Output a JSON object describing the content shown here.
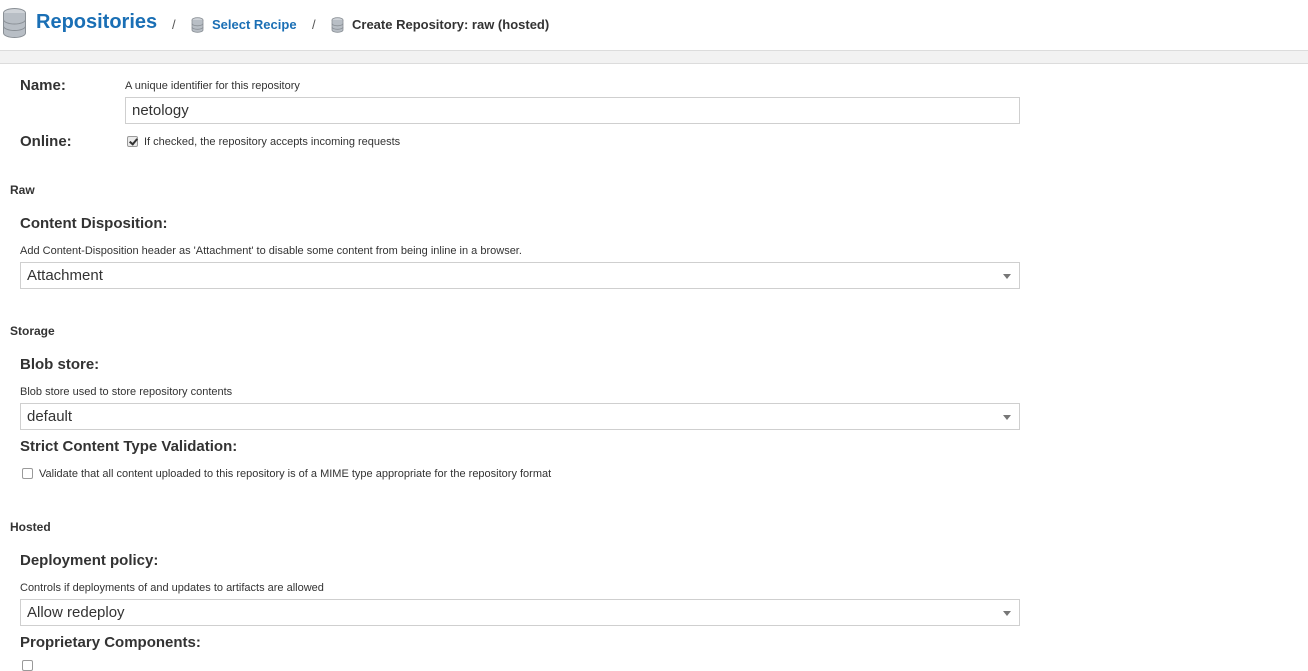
{
  "breadcrumb": {
    "root": "Repositories",
    "separator": "/",
    "step1": "Select Recipe",
    "current": "Create Repository: raw (hosted)"
  },
  "form": {
    "name": {
      "label": "Name:",
      "help": "A unique identifier for this repository",
      "value": "netology"
    },
    "online": {
      "label": "Online:",
      "help": "If checked, the repository accepts incoming requests",
      "checked": true
    },
    "raw": {
      "section": "Raw",
      "content_disposition": {
        "label": "Content Disposition:",
        "help": "Add Content-Disposition header as 'Attachment' to disable some content from being inline in a browser.",
        "value": "Attachment"
      }
    },
    "storage": {
      "section": "Storage",
      "blob_store": {
        "label": "Blob store:",
        "help": "Blob store used to store repository contents",
        "value": "default"
      },
      "strict_validation": {
        "label": "Strict Content Type Validation:",
        "help": "Validate that all content uploaded to this repository is of a MIME type appropriate for the repository format",
        "checked": false
      }
    },
    "hosted": {
      "section": "Hosted",
      "deployment_policy": {
        "label": "Deployment policy:",
        "help": "Controls if deployments of and updates to artifacts are allowed",
        "value": "Allow redeploy"
      },
      "proprietary": {
        "label": "Proprietary Components:",
        "checked": false
      }
    }
  },
  "colors": {
    "link": "#1a6fb5",
    "text": "#333333",
    "border": "#cfcfcf"
  }
}
